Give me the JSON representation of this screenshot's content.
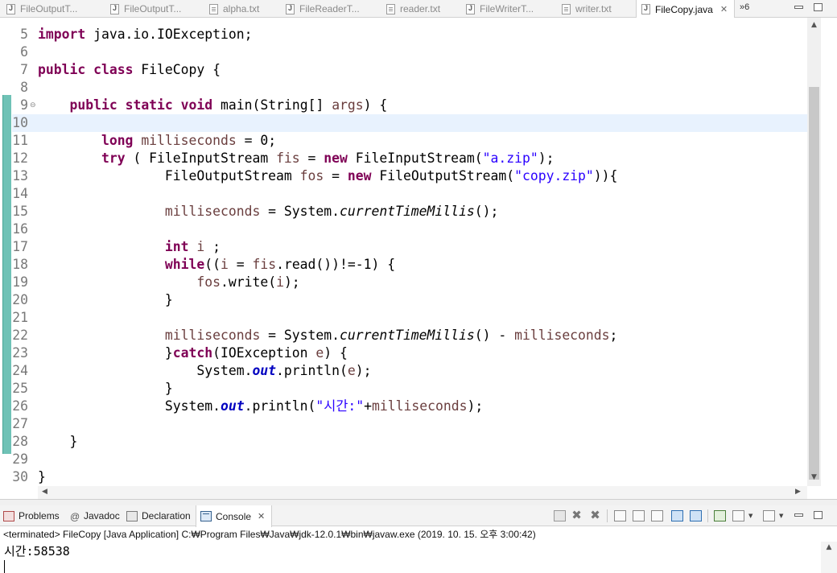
{
  "editor_tabs": [
    {
      "label": "FileOutputT...",
      "icon": "java-file-icon"
    },
    {
      "label": "FileOutputT...",
      "icon": "java-file-icon"
    },
    {
      "label": "alpha.txt",
      "icon": "text-file-icon"
    },
    {
      "label": "FileReaderT...",
      "icon": "java-file-icon"
    },
    {
      "label": "reader.txt",
      "icon": "text-file-icon"
    },
    {
      "label": "FileWriterT...",
      "icon": "java-file-icon"
    },
    {
      "label": "writer.txt",
      "icon": "text-file-icon"
    },
    {
      "label": "FileCopy.java",
      "icon": "java-file-icon",
      "active": true
    }
  ],
  "more_tabs": "»6",
  "code_lines": [
    {
      "num": "5",
      "src": "<span class=\"kw\">import</span> java.io.IOException;"
    },
    {
      "num": "6",
      "src": ""
    },
    {
      "num": "7",
      "src": "<span class=\"kw\">public</span> <span class=\"kw\">class</span> FileCopy {"
    },
    {
      "num": "8",
      "src": ""
    },
    {
      "num": "9",
      "src": "    <span class=\"kw\">public</span> <span class=\"kw\">static</span> <span class=\"kw\">void</span> main(String[] <span class=\"var\">args</span>) {",
      "fold": true
    },
    {
      "num": "10",
      "src": "",
      "current": true
    },
    {
      "num": "11",
      "src": "        <span class=\"kw\">long</span> <span class=\"var\">milliseconds</span> = 0;"
    },
    {
      "num": "12",
      "src": "        <span class=\"kw\">try</span> ( FileInputStream <span class=\"var\">fis</span> = <span class=\"kw\">new</span> FileInputStream(<span class=\"str\">\"a.zip\"</span>);"
    },
    {
      "num": "13",
      "src": "                FileOutputStream <span class=\"var\">fos</span> = <span class=\"kw\">new</span> FileOutputStream(<span class=\"str\">\"copy.zip\"</span>)){"
    },
    {
      "num": "14",
      "src": ""
    },
    {
      "num": "15",
      "src": "                <span class=\"var\">milliseconds</span> = System.<span class=\"ital\">currentTimeMillis</span>();"
    },
    {
      "num": "16",
      "src": ""
    },
    {
      "num": "17",
      "src": "                <span class=\"kw\">int</span> <span class=\"var\">i</span> ;"
    },
    {
      "num": "18",
      "src": "                <span class=\"kw\">while</span>((<span class=\"var\">i</span> = <span class=\"var\">fis</span>.read())!=-1) {"
    },
    {
      "num": "19",
      "src": "                    <span class=\"var\">fos</span>.write(<span class=\"var\">i</span>);"
    },
    {
      "num": "20",
      "src": "                }"
    },
    {
      "num": "21",
      "src": ""
    },
    {
      "num": "22",
      "src": "                <span class=\"var\">milliseconds</span> = System.<span class=\"ital\">currentTimeMillis</span>() - <span class=\"var\">milliseconds</span>;"
    },
    {
      "num": "23",
      "src": "                }<span class=\"kw\">catch</span>(IOException <span class=\"var\">e</span>) {"
    },
    {
      "num": "24",
      "src": "                    System.<span class=\"fld\">out</span>.println(<span class=\"var\">e</span>);"
    },
    {
      "num": "25",
      "src": "                }"
    },
    {
      "num": "26",
      "src": "                System.<span class=\"fld\">out</span>.println(<span class=\"str\">\"시간:\"</span>+<span class=\"var\">milliseconds</span>);"
    },
    {
      "num": "27",
      "src": ""
    },
    {
      "num": "28",
      "src": "    }"
    },
    {
      "num": "29",
      "src": ""
    },
    {
      "num": "30",
      "src": "}"
    }
  ],
  "console_tabs": [
    {
      "label": "Problems",
      "icon": "problems-icon"
    },
    {
      "label": "Javadoc",
      "icon": "javadoc-icon"
    },
    {
      "label": "Declaration",
      "icon": "declaration-icon"
    },
    {
      "label": "Console",
      "icon": "console-icon",
      "active": true
    }
  ],
  "console": {
    "terminated": "<terminated> FileCopy [Java Application] C:₩Program Files₩Java₩jdk-12.0.1₩bin₩javaw.exe (2019. 10. 15. 오후 3:00:42)",
    "output": "시간:58538"
  },
  "colors": {
    "keyword": "#7f0055",
    "string": "#2a00ff",
    "static_field": "#0000c0",
    "local_variable": "#6a3e3e",
    "current_line": "#e8f2fe",
    "quick_diff": "#6fc2b6"
  }
}
